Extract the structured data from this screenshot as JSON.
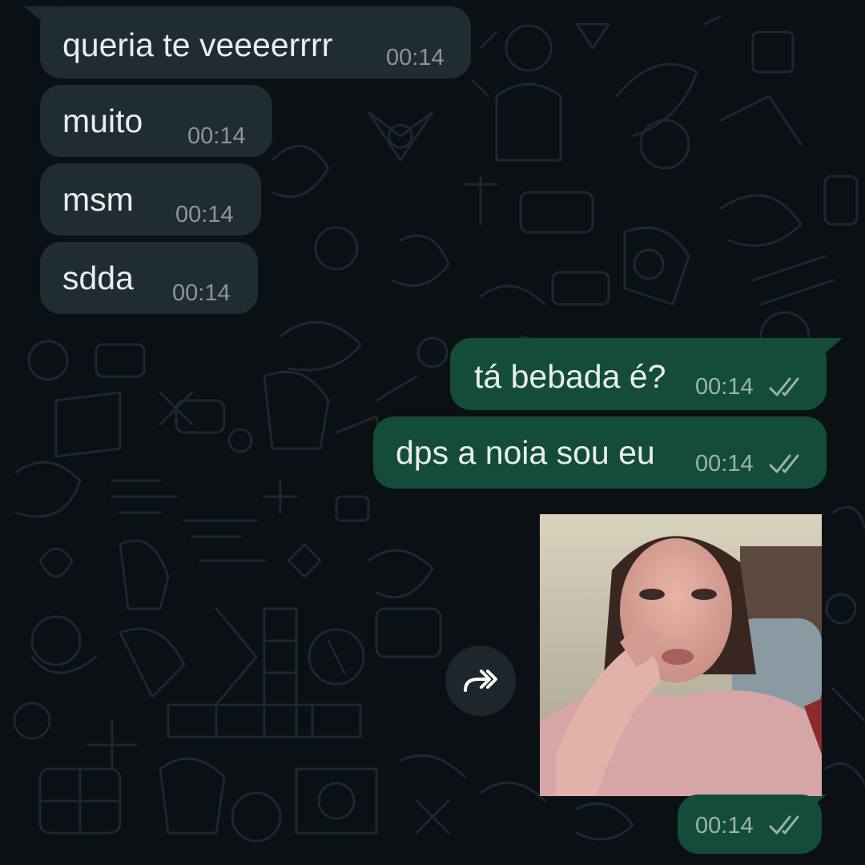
{
  "colors": {
    "background": "#0b1014",
    "incoming_bubble": "#202c33",
    "outgoing_bubble": "#144d37",
    "text": "#e9edef",
    "read_ticks": "#9ab5a8"
  },
  "messages": [
    {
      "direction": "incoming",
      "text": "queria te veeeerrrr",
      "time": "00:14"
    },
    {
      "direction": "incoming",
      "text": "muito",
      "time": "00:14"
    },
    {
      "direction": "incoming",
      "text": "msm",
      "time": "00:14"
    },
    {
      "direction": "incoming",
      "text": "sdda",
      "time": "00:14"
    },
    {
      "direction": "outgoing",
      "text": "tá bebada é?",
      "time": "00:14",
      "status": "read"
    },
    {
      "direction": "outgoing",
      "text": "dps a noia sou eu",
      "time": "00:14",
      "status": "read"
    },
    {
      "direction": "outgoing",
      "type": "image",
      "time": "00:14",
      "status": "read"
    }
  ],
  "icons": {
    "forward": "forward-icon",
    "status": "double-check-icon"
  }
}
